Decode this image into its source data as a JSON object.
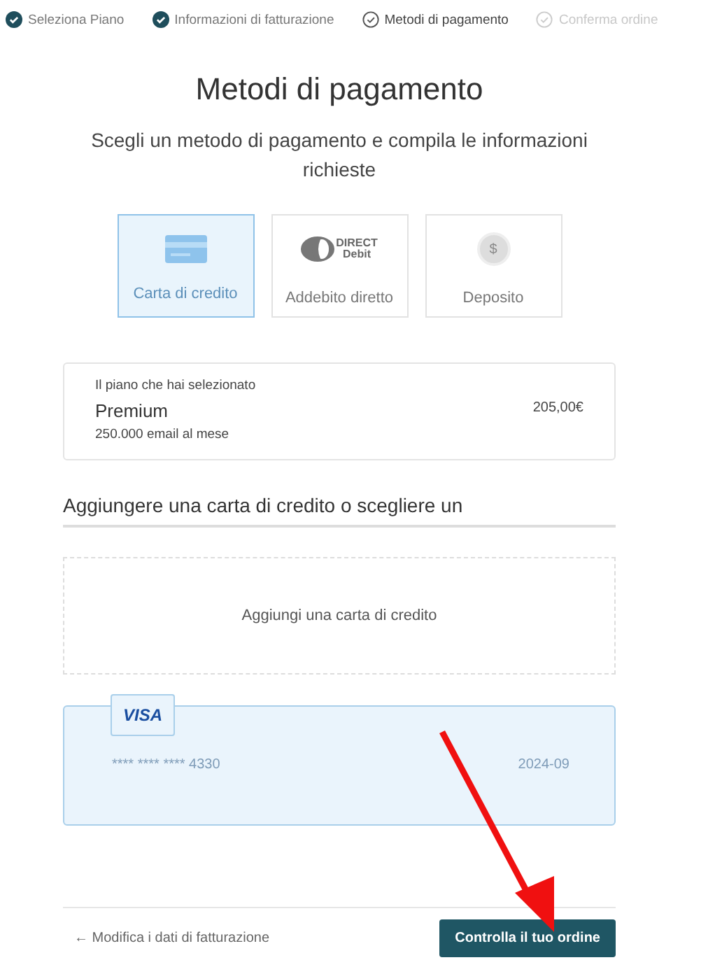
{
  "steps": [
    {
      "label": "Seleziona Piano",
      "done": true,
      "current": false
    },
    {
      "label": "Informazioni di fatturazione",
      "done": true,
      "current": false
    },
    {
      "label": "Metodi di pagamento",
      "done": false,
      "current": true
    },
    {
      "label": "Conferma ordine",
      "done": false,
      "current": false
    }
  ],
  "title": "Metodi di pagamento",
  "subtitle": "Scegli un metodo di pagamento e compila le informazioni richieste",
  "methods": [
    {
      "kind": "card",
      "label": "Carta di credito",
      "selected": true
    },
    {
      "kind": "direct_debit",
      "label": "Addebito diretto",
      "selected": false,
      "logo_text": [
        "DIRECT",
        "Debit"
      ]
    },
    {
      "kind": "deposit",
      "label": "Deposito",
      "selected": false,
      "coin_text": "$"
    }
  ],
  "plan": {
    "caption": "Il piano che hai selezionato",
    "name": "Premium",
    "detail": "250.000 email al mese",
    "price": "205,00€"
  },
  "section_heading": "Aggiungere una carta di credito o scegliere un",
  "add_card": "Aggiungi una carta di credito",
  "saved_cards": [
    {
      "brand": "VISA",
      "number": "**** **** **** 4330",
      "expiry": "2024-09",
      "selected": true
    }
  ],
  "back_link": "← Modifica i dati di fatturazione",
  "primary_button": "Controlla il tuo ordine",
  "annotation": {
    "kind": "arrow"
  }
}
